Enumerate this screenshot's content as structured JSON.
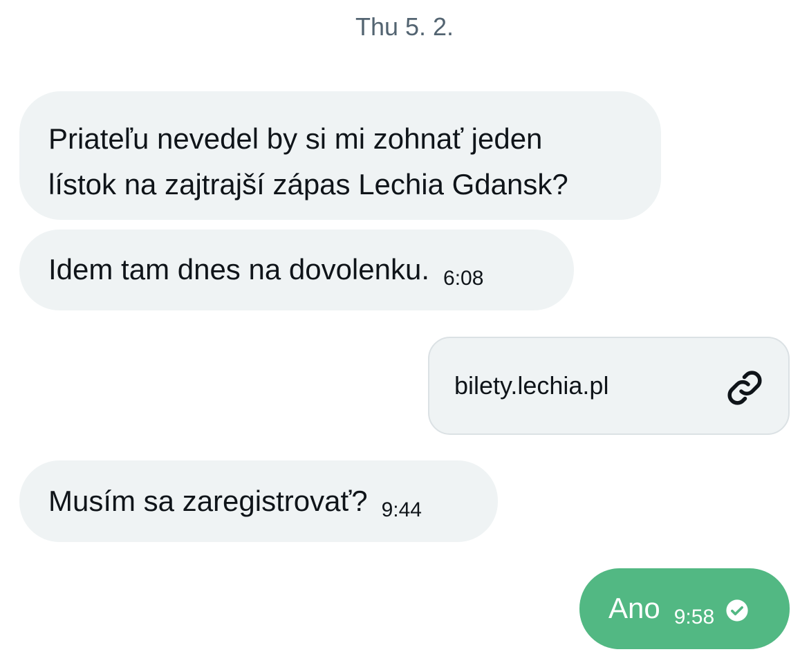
{
  "conversation": {
    "date_separator": "Thu 5. 2.",
    "messages": [
      {
        "direction": "incoming",
        "line1": "Priateľu nevedel by si mi zohnať jeden",
        "line2": "lístok na zajtrajší zápas Lechia Gdansk?"
      },
      {
        "direction": "incoming",
        "text": "Idem tam dnes na dovolenku.",
        "time": "6:08"
      },
      {
        "direction": "outgoing",
        "type": "link",
        "link_text": "bilety.lechia.pl",
        "icon": "link-icon"
      },
      {
        "direction": "incoming",
        "text": "Musím sa zaregistrovať?",
        "time": "9:44"
      },
      {
        "direction": "outgoing",
        "text": "Ano",
        "time": "9:58",
        "status_icon": "read-check-icon"
      }
    ]
  },
  "colors": {
    "incoming_bubble": "#eff3f4",
    "outgoing_bubble": "#52b883",
    "date_text": "#536471",
    "text": "#0f1419"
  }
}
